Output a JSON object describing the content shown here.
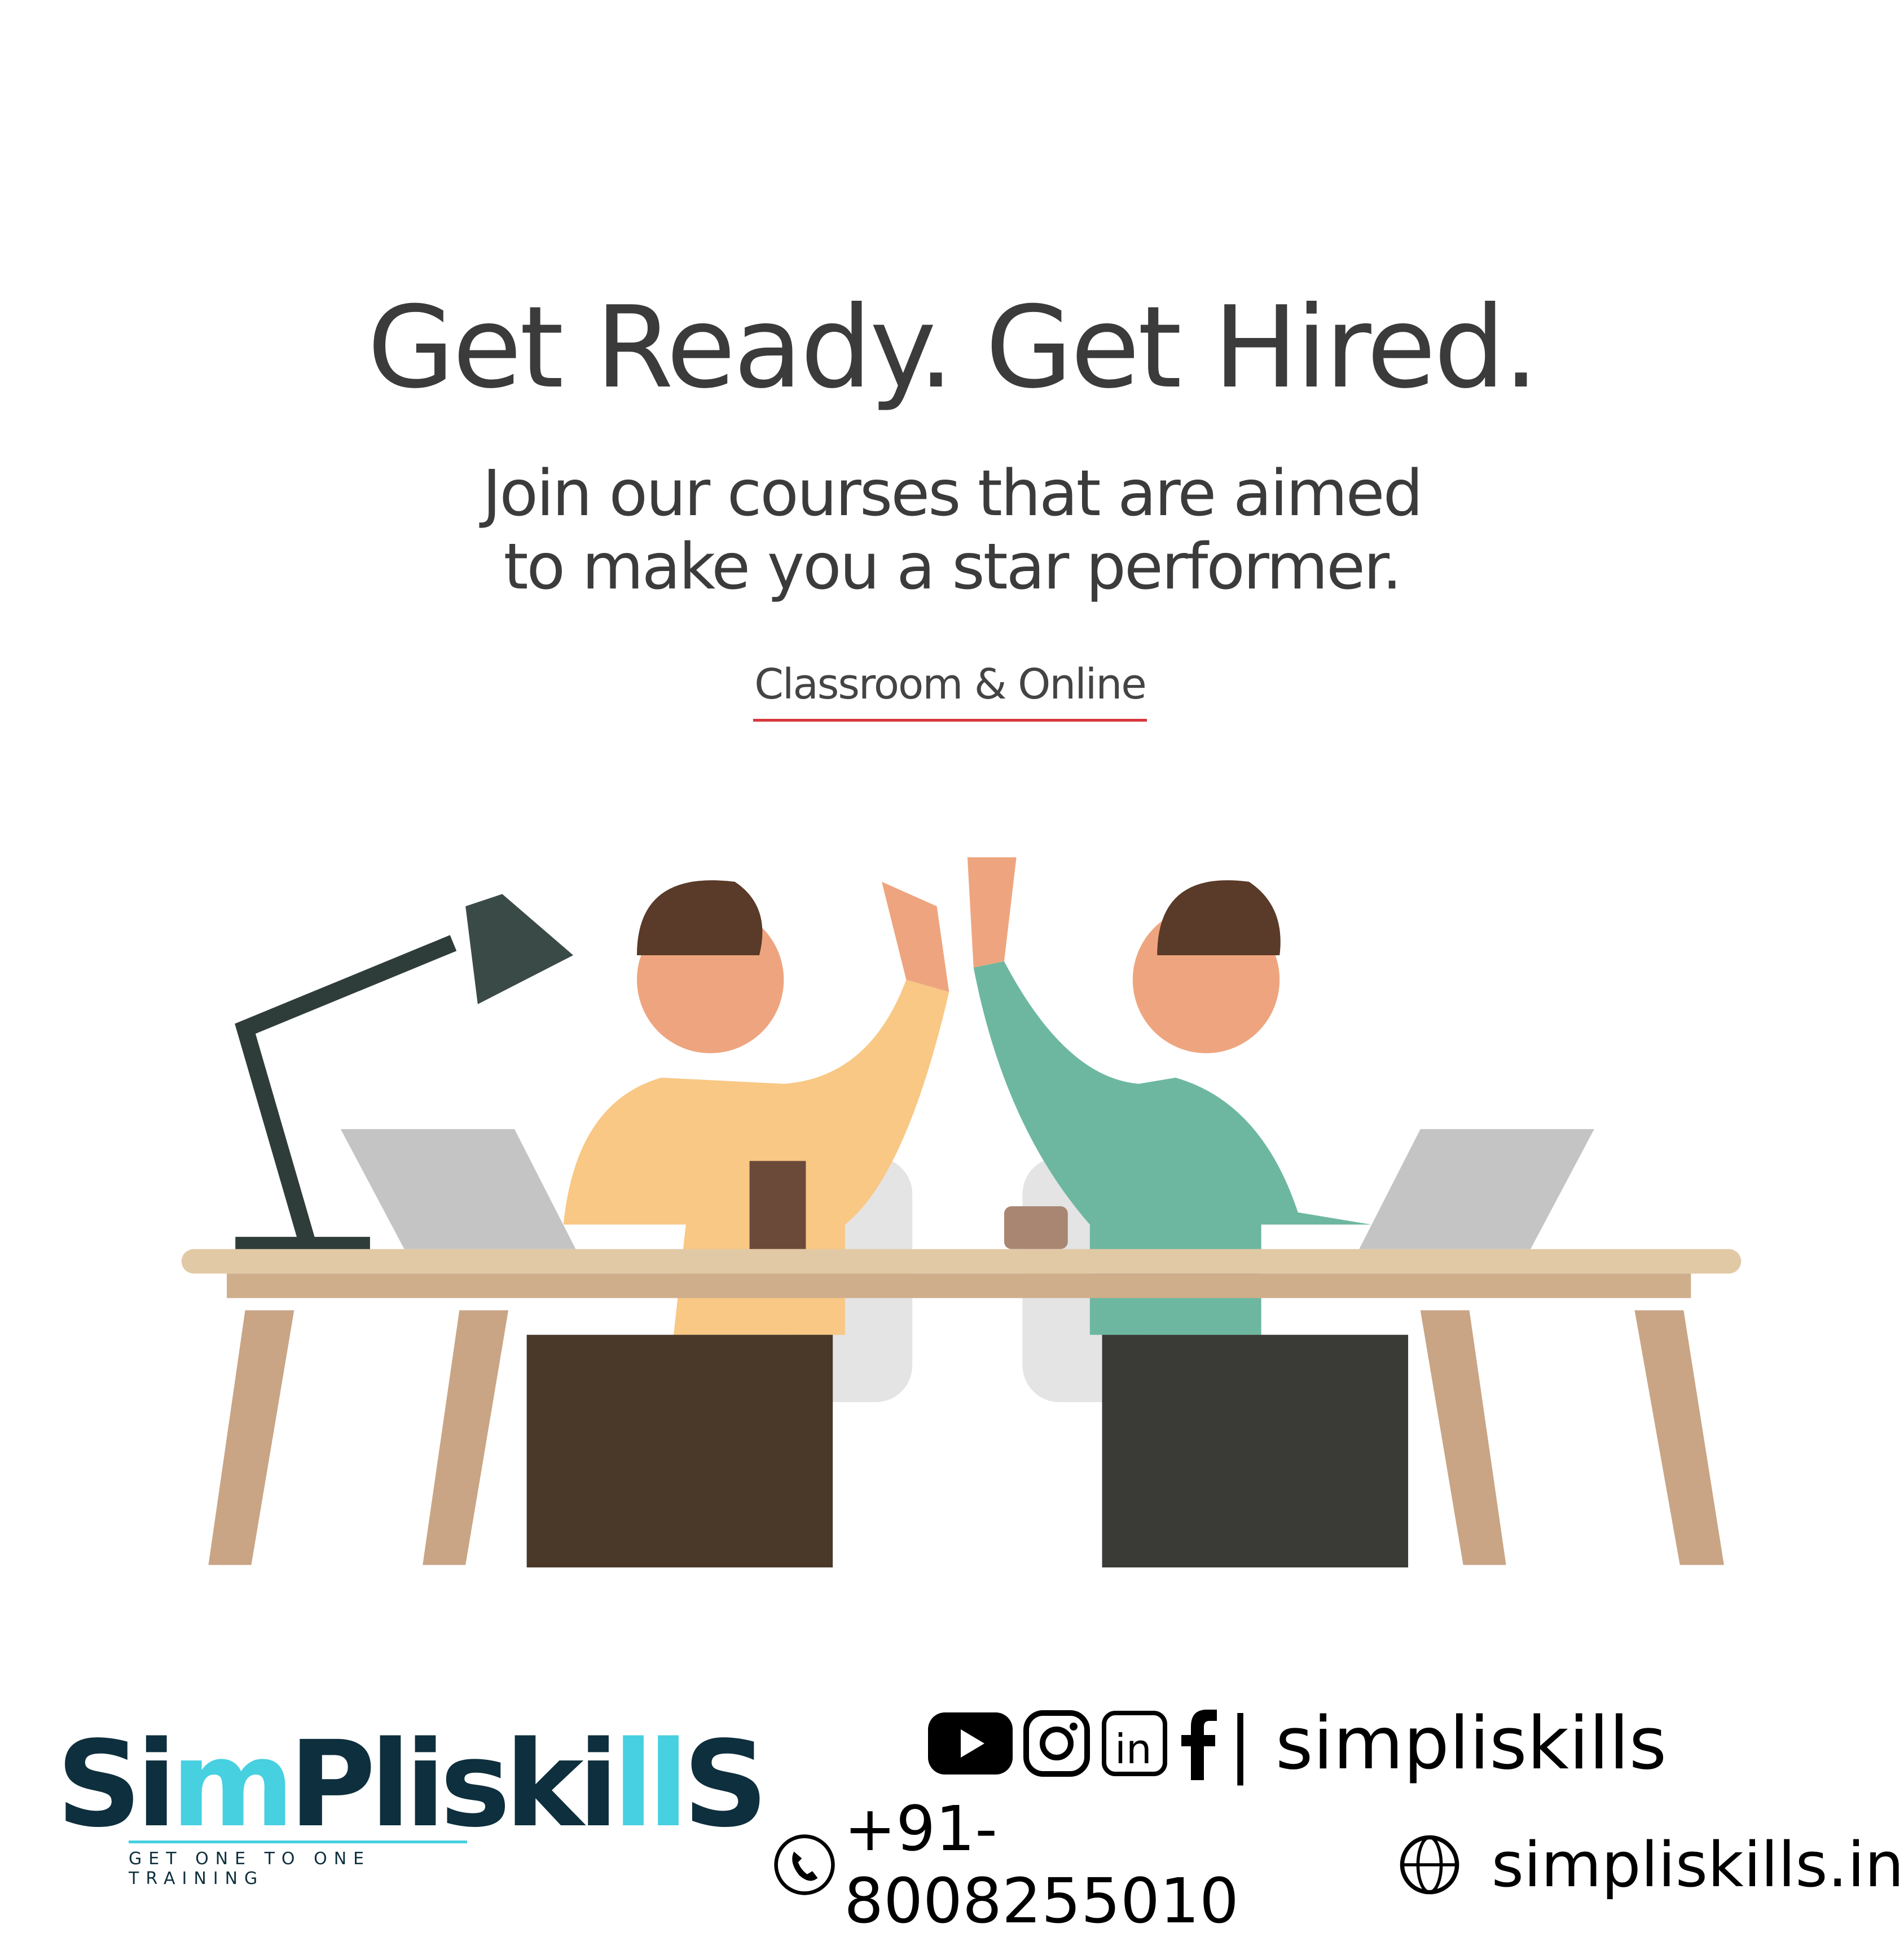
{
  "headline": "Get Ready. Get Hired.",
  "subtitle": {
    "line1": "Join our courses that are aimed",
    "line2": "to make you a star performer."
  },
  "mode_label": "Classroom & Online",
  "brand": {
    "logo_text": "SimPliskills",
    "tagline": "GET ONE TO ONE TRAINING",
    "primary_color": "#0e2f3d",
    "accent_color": "#46d0e0"
  },
  "social": {
    "icons": [
      "youtube-icon",
      "instagram-icon",
      "linkedin-icon",
      "facebook-icon"
    ],
    "handle": "| simpliskills"
  },
  "contact": {
    "phone": "+91-8008255010",
    "website": "simpliskills.in"
  },
  "colors": {
    "underline": "#d9383f",
    "text": "#3b3b3b"
  }
}
